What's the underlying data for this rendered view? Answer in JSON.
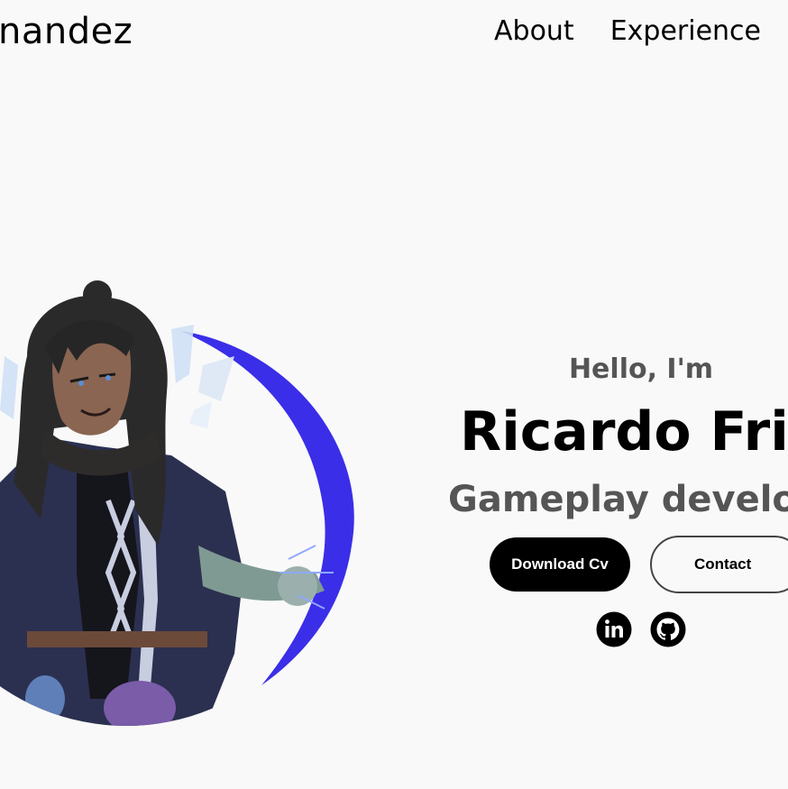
{
  "header": {
    "logo_text": "nandez",
    "nav": [
      {
        "label": "About"
      },
      {
        "label": "Experience"
      }
    ]
  },
  "hero": {
    "greeting": "Hello, I'm",
    "name": "Ricardo Fria",
    "role": "Gameplay develop",
    "buttons": {
      "download_cv": "Download Cv",
      "contact": "Contact"
    },
    "social_icons": [
      "linkedin-icon",
      "github-icon"
    ]
  },
  "colors": {
    "background": "#f9f9f9",
    "text": "#000000",
    "muted_text": "#555555",
    "accent_arc": "#3a2ee8"
  }
}
